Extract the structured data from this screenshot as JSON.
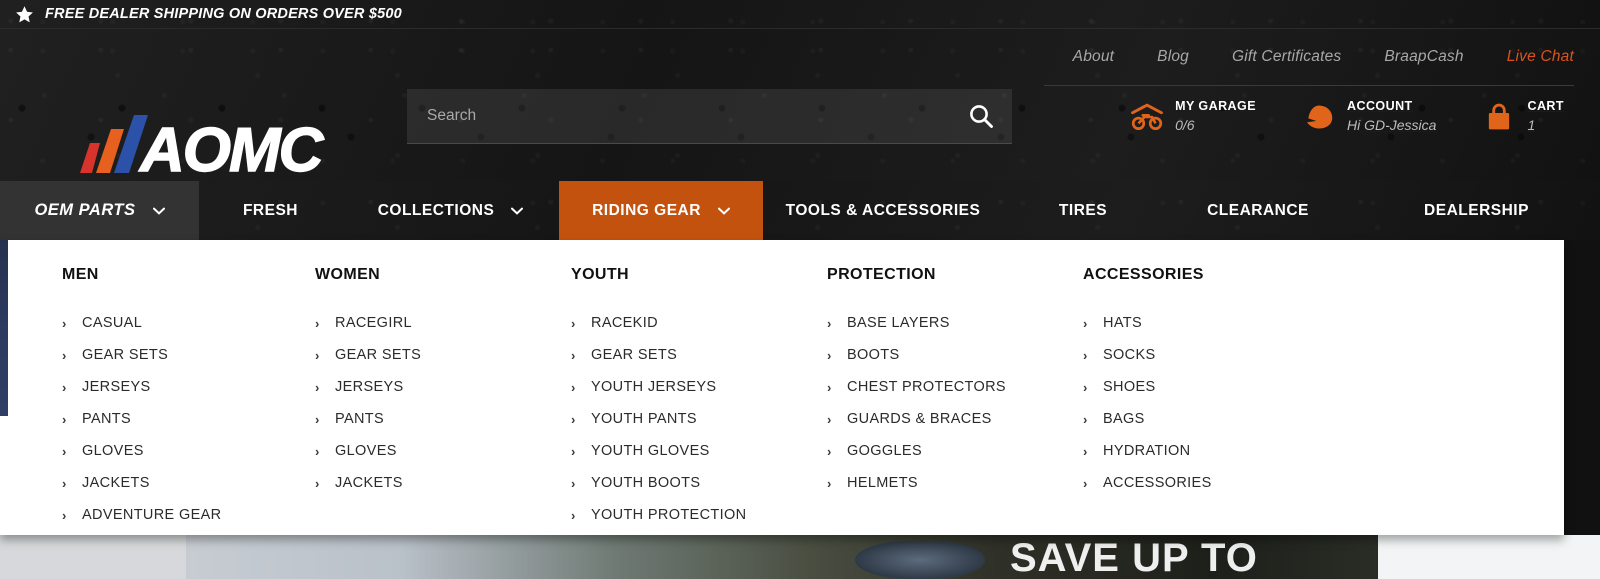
{
  "announcement": {
    "icon": "star-icon",
    "text": "FREE DEALER SHIPPING ON ORDERS OVER $500"
  },
  "brand": {
    "name": "AOMC",
    "colors": {
      "red": "#d9342b",
      "orange": "#e8601d",
      "blue": "#2b52a8",
      "white": "#ffffff"
    }
  },
  "utility_links": [
    {
      "label": "About",
      "highlight": false
    },
    {
      "label": "Blog",
      "highlight": false
    },
    {
      "label": "Gift Certificates",
      "highlight": false
    },
    {
      "label": "BraapCash",
      "highlight": false
    },
    {
      "label": "Live Chat",
      "highlight": true
    }
  ],
  "search": {
    "placeholder": "Search",
    "value": "",
    "button_icon": "search-icon"
  },
  "account_widgets": [
    {
      "icon": "garage-motorcycle-icon",
      "label": "MY GARAGE",
      "value": "0/6"
    },
    {
      "icon": "helmet-icon",
      "label": "ACCOUNT",
      "value": "Hi GD-Jessica"
    },
    {
      "icon": "cart-bag-icon",
      "label": "CART",
      "value": "1"
    }
  ],
  "nav": [
    {
      "label": "OEM PARTS",
      "has_dropdown": true,
      "active": false,
      "style": "oem"
    },
    {
      "label": "FRESH",
      "has_dropdown": false,
      "active": false,
      "style": "fresh"
    },
    {
      "label": "COLLECTIONS",
      "has_dropdown": true,
      "active": false,
      "style": "collections"
    },
    {
      "label": "RIDING GEAR",
      "has_dropdown": true,
      "active": true,
      "style": "riding"
    },
    {
      "label": "TOOLS & ACCESSORIES",
      "has_dropdown": false,
      "active": false,
      "style": "tools"
    },
    {
      "label": "TIRES",
      "has_dropdown": false,
      "active": false,
      "style": "tires"
    },
    {
      "label": "CLEARANCE",
      "has_dropdown": false,
      "active": false,
      "style": "clearance"
    },
    {
      "label": "DEALERSHIP",
      "has_dropdown": false,
      "active": false,
      "style": "dealership"
    }
  ],
  "mega_menu": {
    "open_for": "RIDING GEAR",
    "columns": [
      {
        "heading": "MEN",
        "items": [
          "CASUAL",
          "GEAR SETS",
          "JERSEYS",
          "PANTS",
          "GLOVES",
          "JACKETS",
          "ADVENTURE GEAR"
        ]
      },
      {
        "heading": "WOMEN",
        "items": [
          "RACEGIRL",
          "GEAR SETS",
          "JERSEYS",
          "PANTS",
          "GLOVES",
          "JACKETS"
        ]
      },
      {
        "heading": "YOUTH",
        "items": [
          "RACEKID",
          "GEAR SETS",
          "YOUTH JERSEYS",
          "YOUTH PANTS",
          "YOUTH GLOVES",
          "YOUTH BOOTS",
          "YOUTH PROTECTION"
        ]
      },
      {
        "heading": "PROTECTION",
        "items": [
          "BASE LAYERS",
          "BOOTS",
          "CHEST PROTECTORS",
          "GUARDS & BRACES",
          "GOGGLES",
          "HELMETS"
        ]
      },
      {
        "heading": "ACCESSORIES",
        "items": [
          "HATS",
          "SOCKS",
          "SHOES",
          "BAGS",
          "HYDRATION",
          "ACCESSORIES"
        ]
      }
    ],
    "item_arrow": "chevron-right-icon"
  },
  "hero_banner": {
    "text": "SAVE UP TO"
  },
  "theme": {
    "accent_orange": "#c4520f",
    "link_orange": "#d9531e",
    "header_bg": "#191919",
    "oem_tab_bg": "#333333",
    "menu_bg": "#ffffff",
    "navy_strip": "#2c3a60"
  }
}
